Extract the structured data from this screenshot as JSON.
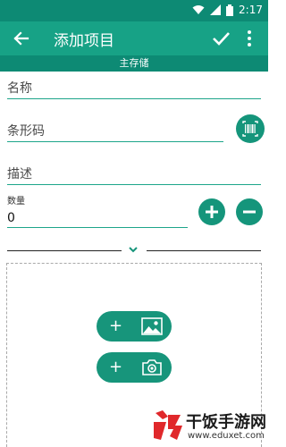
{
  "status": {
    "time": "2:17"
  },
  "appbar": {
    "title": "添加项目"
  },
  "storage": {
    "label": "主存储"
  },
  "form": {
    "name_label": "名称",
    "barcode_label": "条形码",
    "description_label": "描述",
    "quantity_label": "数量",
    "quantity_value": "0"
  },
  "colors": {
    "primary": "#17a286",
    "dark": "#0d8a74",
    "accent": "#15957b"
  },
  "icons": {
    "back": "arrow-left-icon",
    "save": "check-icon",
    "more": "more-vert-icon",
    "barcode": "barcode-scan-icon",
    "increment": "plus-icon",
    "decrement": "minus-icon",
    "expand": "chevron-down-icon",
    "add_image": "image-icon",
    "add_photo": "camera-icon"
  },
  "buttons": {
    "add_image_plus": "+",
    "add_photo_plus": "+"
  },
  "watermark": {
    "text": "干饭手游网",
    "url": "www.eduxet.com"
  }
}
